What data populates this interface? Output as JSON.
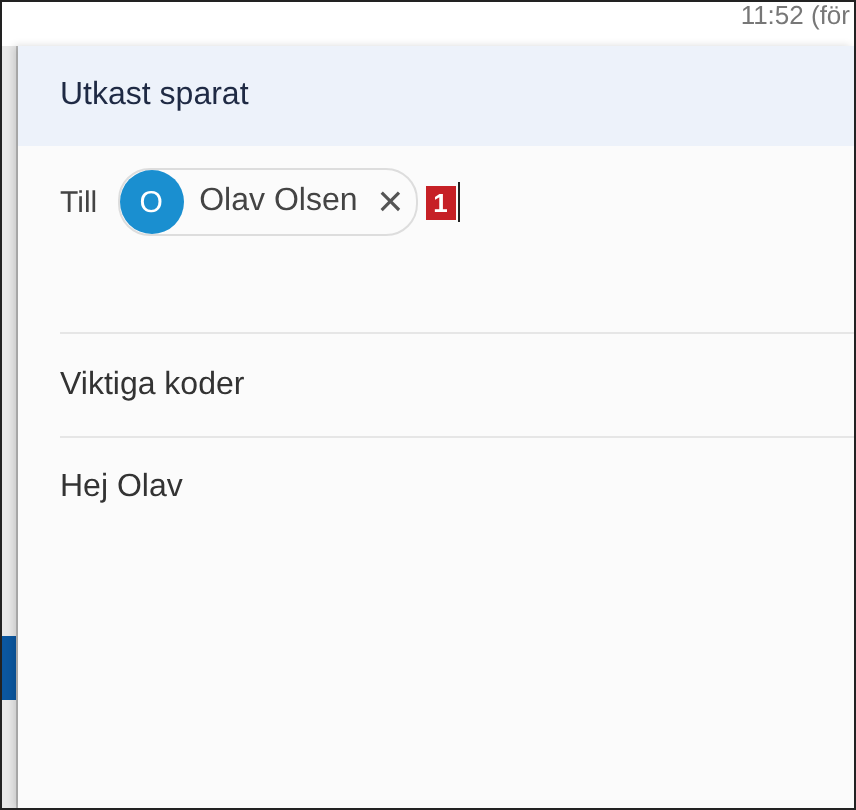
{
  "timestamp": "11:52 (för",
  "compose": {
    "title": "Utkast sparat",
    "to": {
      "label": "Till",
      "recipients": [
        {
          "initial": "O",
          "name": "Olav Olsen",
          "remove": "×",
          "badge": "1"
        }
      ]
    },
    "subject": "Viktiga koder",
    "body": "Hej Olav"
  }
}
